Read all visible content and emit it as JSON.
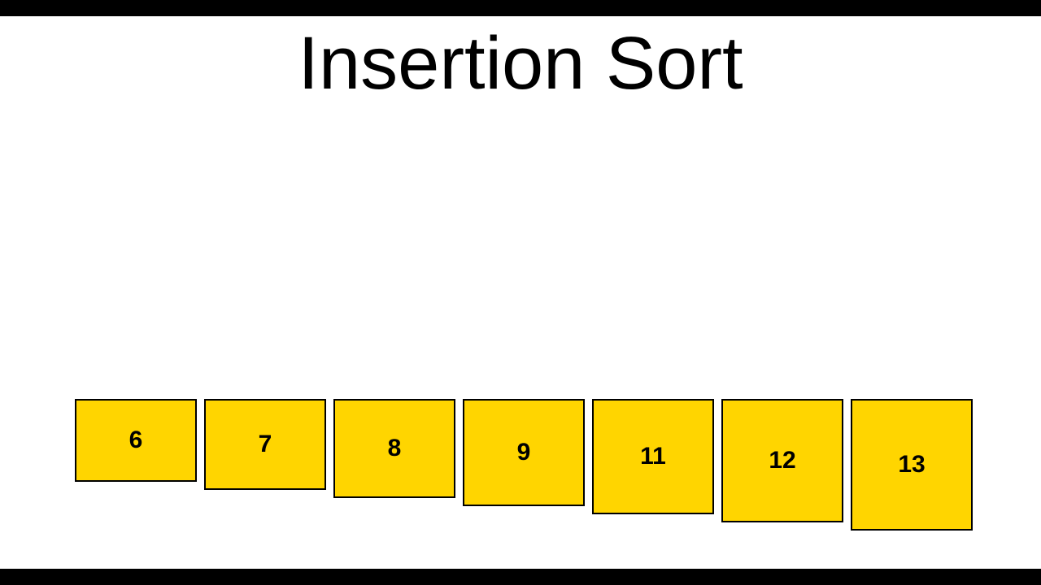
{
  "title": "Insertion Sort",
  "colors": {
    "cell_fill": "#ffd500",
    "cell_border": "#000000",
    "background": "#ffffff",
    "letterbox": "#000000"
  },
  "array": {
    "values": [
      "6",
      "7",
      "8",
      "9",
      "11",
      "12",
      "13"
    ]
  }
}
